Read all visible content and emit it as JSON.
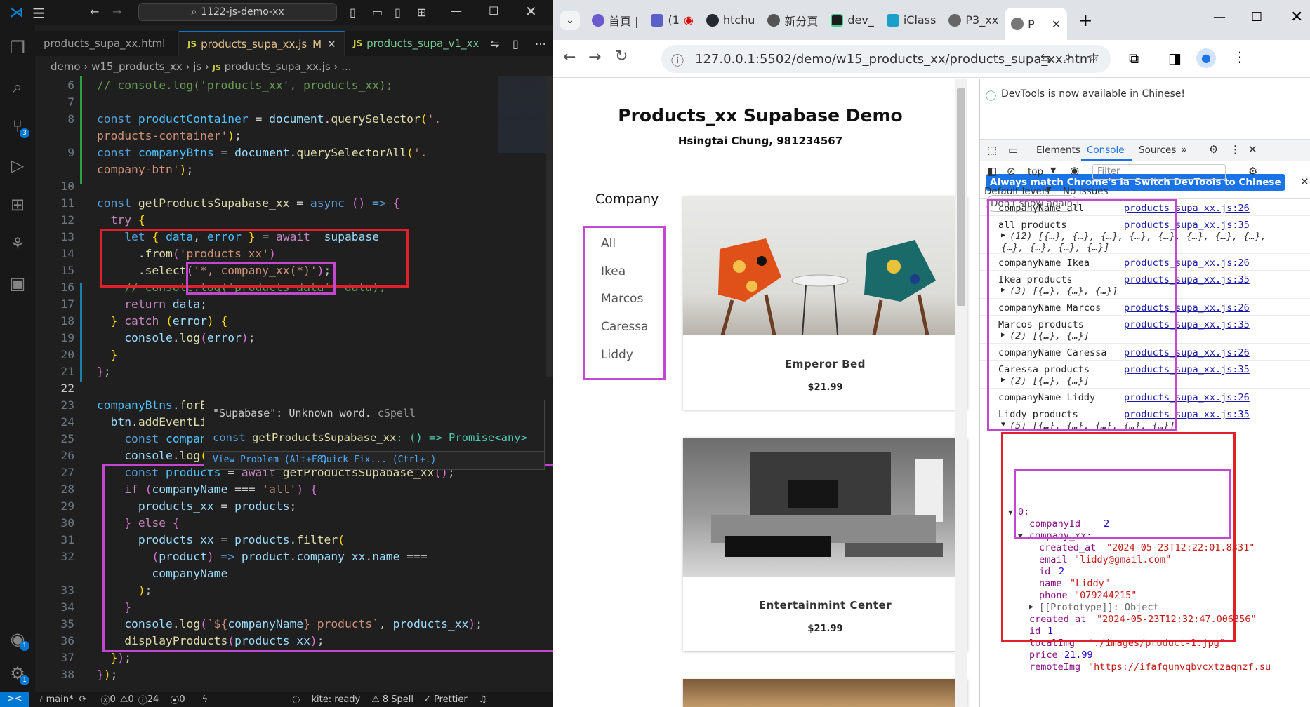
{
  "vscode": {
    "search": "1122-js-demo-xx",
    "tabs": [
      {
        "label": "products_supa_xx.html"
      },
      {
        "label": "products_supa_xx.js",
        "badge": "M"
      },
      {
        "label": "products_supa_v1_xx"
      }
    ],
    "breadcrumbs": [
      "demo",
      "w15_products_xx",
      "js",
      "products_supa_xx.js",
      "..."
    ],
    "badges": {
      "scm": "3",
      "accounts": "1",
      "settings": "1"
    },
    "hover": {
      "message": "\"Supabase\": Unknown word.",
      "source": "cSpell",
      "signature_const": "const",
      "signature_name": "getProductsSupabase_xx",
      "signature_type": ": () => Promise<any>",
      "view_problem": "View Problem (Alt+F8)",
      "quick_fix": "Quick Fix... (Ctrl+.)"
    },
    "status": {
      "remote": "><",
      "branch": "main*",
      "errors": "0",
      "warnings": "0",
      "info": "24",
      "ports": "0",
      "kite": "kite: ready",
      "spell": "8 Spell",
      "prettier": "Prettier"
    }
  },
  "browser": {
    "tabs": [
      "首頁 |",
      "(1",
      "htchu",
      "新分頁",
      "dev_",
      "iClass",
      "P3_xx",
      "P"
    ],
    "url": "127.0.0.1:5502/demo/w15_products_xx/products_supa_xx.html",
    "page": {
      "title": "Products_xx Supabase Demo",
      "subtitle": "Hsingtai Chung, 981234567",
      "company_heading": "Company",
      "companies": [
        "All",
        "Ikea",
        "Marcos",
        "Caressa",
        "Liddy"
      ],
      "products": [
        {
          "name": "Emperor Bed",
          "price": "$21.99"
        },
        {
          "name": "Entertainmint Center",
          "price": "$21.99"
        }
      ]
    },
    "devtools": {
      "notice": "DevTools is now available in Chinese!",
      "btn_match": "Always match Chrome's language",
      "btn_switch": "Switch DevTools to Chinese",
      "btn_dont": "Don't show again",
      "panels": [
        "Elements",
        "Console",
        "Sources"
      ],
      "context": "top",
      "filter_placeholder": "Filter",
      "levels": "Default levels",
      "issues": "No Issues",
      "logs": [
        {
          "text": "companyName all",
          "src": "products_supa_xx.js:26"
        },
        {
          "text": "all products",
          "src": "products_supa_xx.js:35",
          "detail": "(12) [{…}, {…}, {…}, {…}, {…}, {…}, {…}, {…},",
          "detail2": "{…}, {…}, {…}, {…}]"
        },
        {
          "text": "companyName Ikea",
          "src": "products_supa_xx.js:26"
        },
        {
          "text": "Ikea products",
          "src": "products_supa_xx.js:35",
          "detail": "(3) [{…}, {…}, {…}]"
        },
        {
          "text": "companyName Marcos",
          "src": "products_supa_xx.js:26"
        },
        {
          "text": "Marcos products",
          "src": "products_supa_xx.js:35",
          "detail": "(2) [{…}, {…}]"
        },
        {
          "text": "companyName Caressa",
          "src": "products_supa_xx.js:26"
        },
        {
          "text": "Caressa products",
          "src": "products_supa_xx.js:35",
          "detail": "(2) [{…}, {…}]"
        },
        {
          "text": "companyName Liddy",
          "src": "products_supa_xx.js:26"
        },
        {
          "text": "Liddy products",
          "src": "products_supa_xx.js:35",
          "detail": "(5) [{…}, {…}, {…}, {…}, {…}]"
        }
      ],
      "obj": {
        "index": "0:",
        "companyId_k": "companyId",
        "companyId_v": "2",
        "company_k": "company_xx:",
        "created_k": "created_at",
        "created_v": "\"2024-05-23T12:22:01.8331\"",
        "email_k": "email",
        "email_v": "\"liddy@gmail.com\"",
        "id_k": "id",
        "id_v": "2",
        "name_k": "name",
        "name_v": "\"Liddy\"",
        "phone_k": "phone",
        "phone_v": "\"079244215\"",
        "proto": "[[Prototype]]: Object",
        "pcreated_k": "created_at",
        "pcreated_v": "\"2024-05-23T12:32:47.006356\"",
        "pid_k": "id",
        "pid_v": "1",
        "img_k": "localImg",
        "img_v": "\"./images/product-1.jpg\"",
        "price_k": "price",
        "price_v": "21.99",
        "remote_k": "remoteImg",
        "remote_v": "\"https://ifafqunvqbvcxtzaqnzf.su"
      }
    }
  }
}
